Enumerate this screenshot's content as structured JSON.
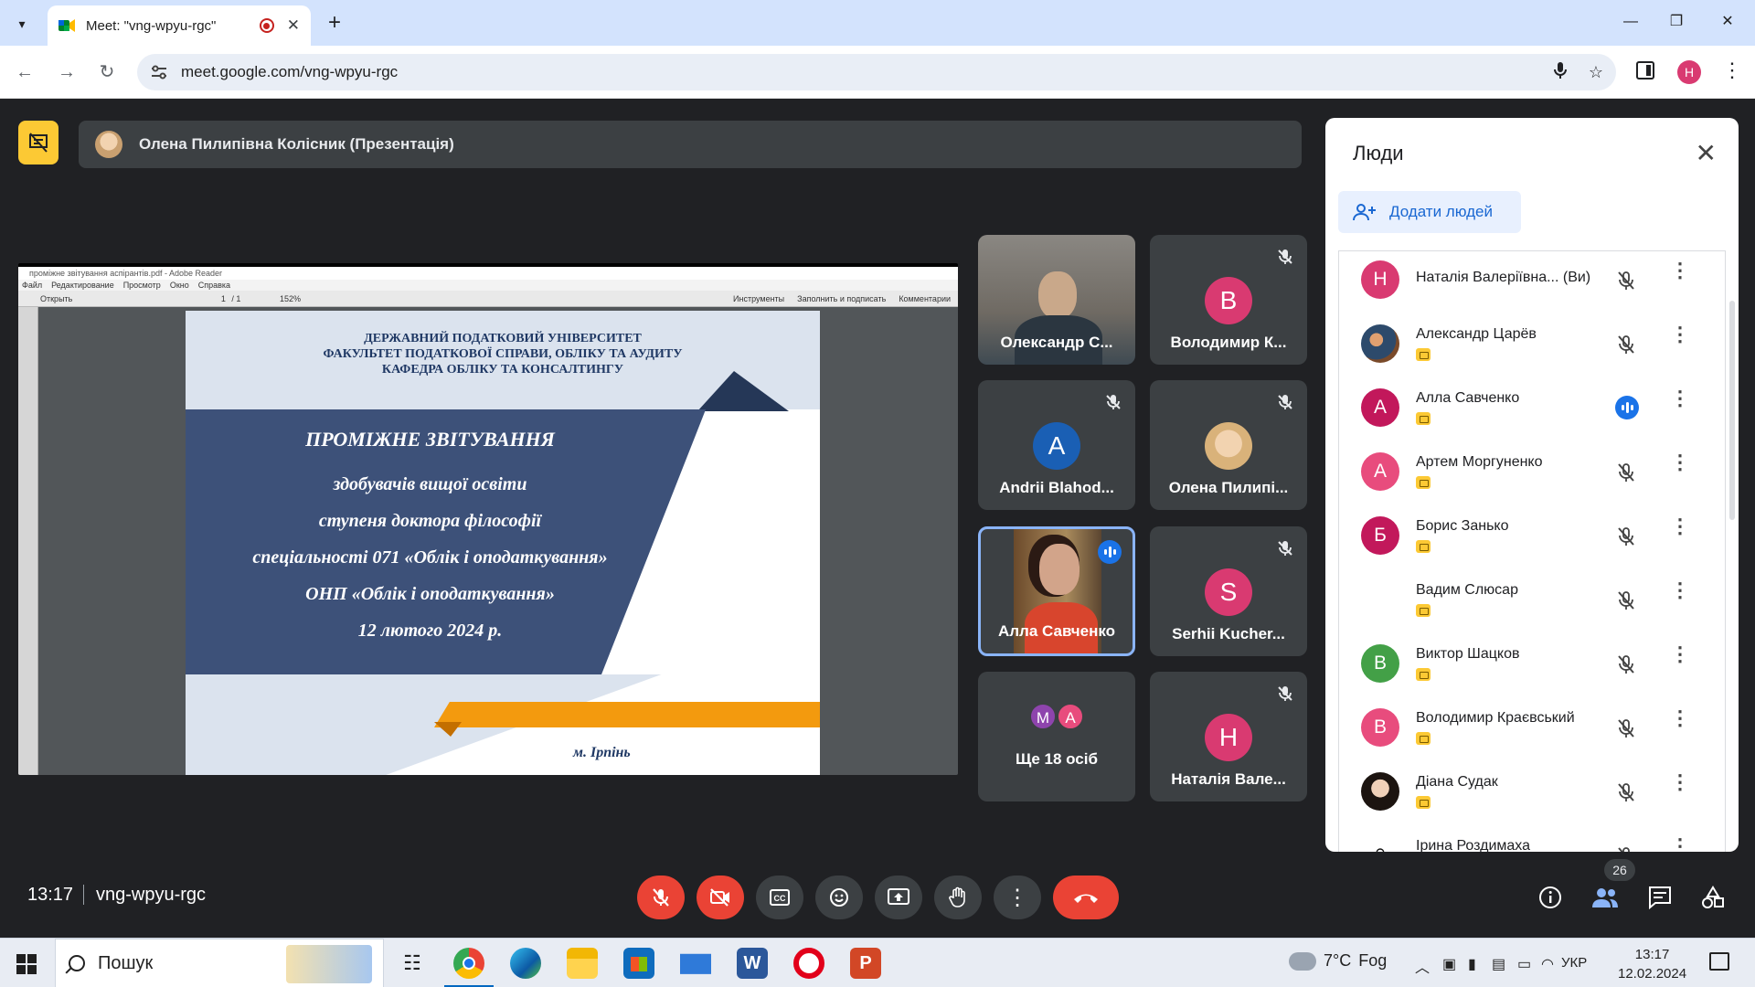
{
  "browser": {
    "tab_title": "Meet: \"vng-wpyu-rgc\"",
    "new_tab_label": "+",
    "url": "meet.google.com/vng-wpyu-rgc",
    "profile_initial": "H",
    "window_controls": {
      "minimize": "—",
      "restore": "❐",
      "close": "✕"
    }
  },
  "presentation": {
    "presenter_label": "Олена Пилипівна Колісник (Презентація)",
    "reader": {
      "title": "проміжне звітування аспірантів.pdf - Adobe Reader",
      "menu": [
        "Файл",
        "Редактирование",
        "Просмотр",
        "Окно",
        "Справка"
      ],
      "open_label": "Открыть",
      "page_num": "1",
      "page_total": "/ 1",
      "zoom": "152%",
      "right_tools": [
        "Инструменты",
        "Заполнить и подписать",
        "Комментарии"
      ]
    },
    "slide": {
      "header_lines": [
        "ДЕРЖАВНИЙ ПОДАТКОВИЙ УНІВЕРСИТЕТ",
        "ФАКУЛЬТЕТ ПОДАТКОВОЇ СПРАВИ, ОБЛІКУ ТА АУДИТУ",
        "КАФЕДРА ОБЛІКУ ТА КОНСАЛТИНГУ"
      ],
      "title": "ПРОМІЖНЕ ЗВІТУВАННЯ",
      "lines": [
        "здобувачів вищої освіти",
        "ступеня доктора філософії",
        "спеціальності 071 «Облік і оподаткування»",
        "ОНП «Облік і оподаткування»",
        "12 лютого 2024 р."
      ],
      "city": "м. Ірпінь"
    }
  },
  "tiles": [
    {
      "name": "Олександр С...",
      "type": "video"
    },
    {
      "name": "Володимир К...",
      "initial": "В",
      "color": "#d93a71",
      "muted": true
    },
    {
      "name": "Andrii Blahod...",
      "initial": "A",
      "color": "#1a5fb4",
      "muted": true
    },
    {
      "name": "Олена Пилипі...",
      "type": "photo",
      "muted": true
    },
    {
      "name": "Алла Савченко",
      "type": "video",
      "speaking": true
    },
    {
      "name": "Serhii Kucher...",
      "initial": "S",
      "color": "#d93a71",
      "muted": true
    },
    {
      "name": "Ще 18 осіб",
      "initials": [
        "M",
        "A"
      ]
    },
    {
      "name": "Наталія Вале...",
      "initial": "H",
      "color": "#d93a71",
      "muted": true
    }
  ],
  "people_panel": {
    "heading": "Люди",
    "add_label": "Додати людей",
    "participants": [
      {
        "name": "Наталія Валеріївна... (Ви)",
        "initial": "H",
        "color": "#d93a71",
        "badge": false,
        "status": "muted"
      },
      {
        "name": "Александр Царёв",
        "avatar": "photo",
        "badge": true,
        "status": "muted"
      },
      {
        "name": "Алла Савченко",
        "initial": "A",
        "color": "#c2185b",
        "badge": true,
        "status": "speaking"
      },
      {
        "name": "Артем Моргуненко",
        "initial": "A",
        "color": "#e84c7d",
        "badge": true,
        "status": "muted"
      },
      {
        "name": "Борис Занько",
        "initial": "Б",
        "color": "#c2185b",
        "badge": true,
        "status": "muted"
      },
      {
        "name": "Вадим Слюсар",
        "avatar": "none",
        "badge": true,
        "status": "muted"
      },
      {
        "name": "Виктор Шацков",
        "initial": "B",
        "color": "#43a047",
        "badge": true,
        "status": "muted"
      },
      {
        "name": "Володимир Краєвський",
        "initial": "B",
        "color": "#e84c7d",
        "badge": true,
        "status": "muted"
      },
      {
        "name": "Діана Судак",
        "avatar": "photo",
        "badge": true,
        "status": "muted"
      },
      {
        "name": "Ірина Роздимаха",
        "avatar": "photo",
        "badge": false,
        "status": "muted"
      }
    ]
  },
  "controls": {
    "time": "13:17",
    "meeting_code": "vng-wpyu-rgc",
    "participant_count": "26"
  },
  "taskbar": {
    "search_text": "Пошук",
    "weather_temp": "7°C",
    "weather_desc": "Fog",
    "language": "УКР",
    "clock_time": "13:17",
    "clock_date": "12.02.2024"
  }
}
